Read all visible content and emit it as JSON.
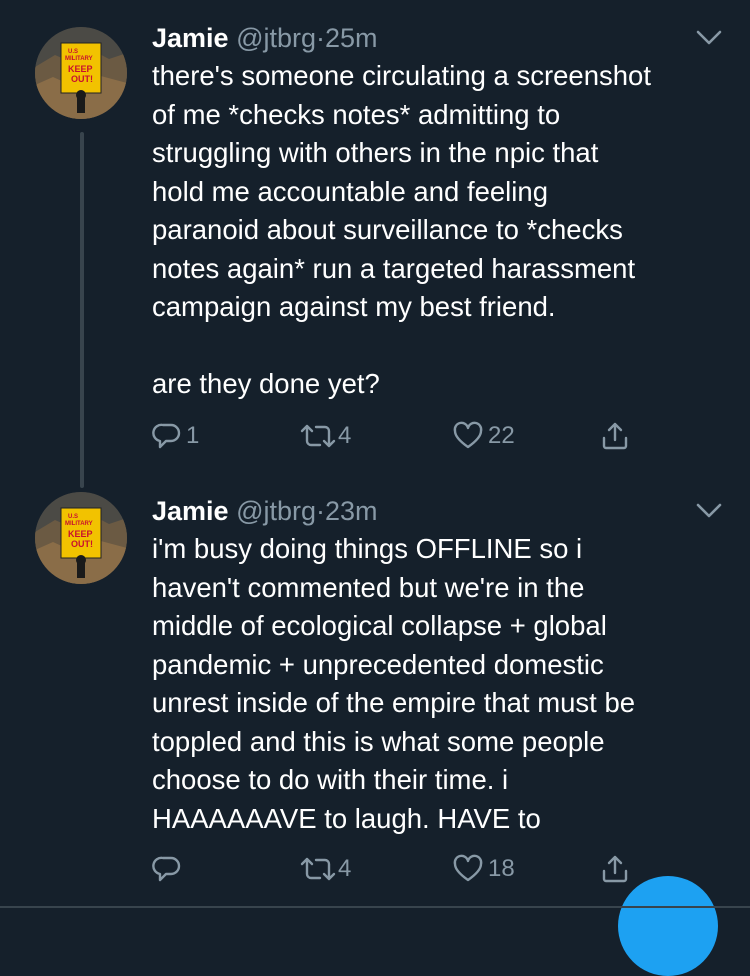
{
  "tweets": [
    {
      "display_name": "Jamie",
      "handle": "@jtbrg",
      "separator": "·",
      "time": "25m",
      "avatar_sign_lines": [
        "U.S",
        "MILITARY",
        "KEEP",
        "OUT!"
      ],
      "lines": [
        "there's someone circulating a screenshot",
        "of me *checks notes* admitting to",
        "struggling with others in the npic that",
        "hold me accountable and feeling",
        "paranoid about surveillance to *checks",
        "notes again* run a targeted harassment",
        "campaign against my best friend.",
        "",
        "are they done yet?"
      ],
      "actions": {
        "reply_count": "1",
        "retweet_count": "4",
        "like_count": "22",
        "reply_icon": "reply-icon",
        "retweet_icon": "retweet-icon",
        "like_icon": "heart-icon",
        "share_icon": "share-icon"
      }
    },
    {
      "display_name": "Jamie",
      "handle": "@jtbrg",
      "separator": "·",
      "time": "23m",
      "avatar_sign_lines": [
        "U.S",
        "MILITARY",
        "KEEP",
        "OUT!"
      ],
      "lines": [
        "i'm busy doing things OFFLINE so i",
        "haven't commented but we're in the",
        "middle of ecological collapse + global",
        "pandemic + unprecedented domestic",
        "unrest inside of the empire that must be",
        "toppled and this is what some people",
        "choose to do with their time. i",
        "HAAAAAAVE to laugh. HAVE to"
      ],
      "actions": {
        "reply_count": "",
        "retweet_count": "4",
        "like_count": "18",
        "reply_icon": "reply-icon",
        "retweet_icon": "retweet-icon",
        "like_icon": "heart-icon",
        "share_icon": "share-icon"
      }
    }
  ],
  "colors": {
    "background": "#15202b",
    "text_primary": "#ffffff",
    "text_secondary": "#8899a6",
    "thread_line": "#38444d",
    "accent": "#1da1f2",
    "sign_yellow": "#f2c200",
    "sign_red": "#c8102e"
  }
}
